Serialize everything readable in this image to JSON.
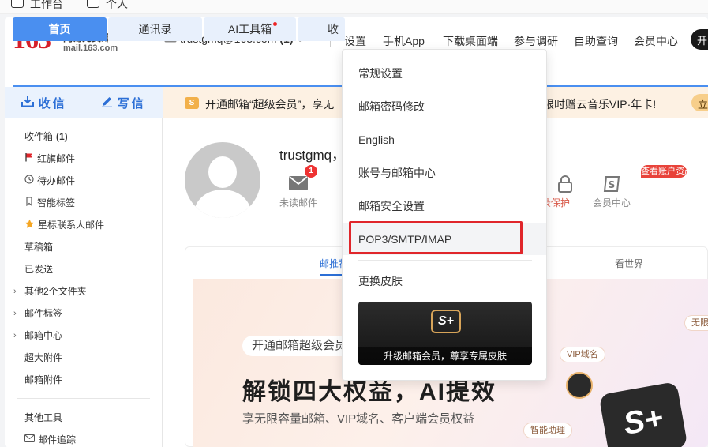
{
  "top_strip": {
    "items": [
      "工作台",
      "个人"
    ]
  },
  "header": {
    "logo_num": "163",
    "logo_cn": "网易免费邮",
    "logo_en": "mail.163.com",
    "account_email": "trustgmq@163.com",
    "account_count": "(1)",
    "nav": [
      "设置",
      "手机App",
      "下载桌面端",
      "参与调研",
      "自助查询",
      "会员中心"
    ],
    "vip_btn": "开"
  },
  "tabs": [
    {
      "label": "首页"
    },
    {
      "label": "通讯录"
    },
    {
      "label": "AI工具箱"
    },
    {
      "label": "收"
    }
  ],
  "sidebar": {
    "receive": "收信",
    "write": "写信",
    "inbox": "收件箱",
    "inbox_count": "(1)",
    "items": [
      "红旗邮件",
      "待办邮件",
      "智能标签",
      "星标联系人邮件",
      "草稿箱",
      "已发送",
      "其他2个文件夹",
      "邮件标签",
      "邮箱中心",
      "超大附件",
      "邮箱附件",
      "其他工具",
      "邮件追踪"
    ]
  },
  "banner": {
    "icon_text": "S",
    "text_left": "开通邮箱“超级会员”，享无",
    "text_right": "益，限时赠云音乐VIP·年卡!",
    "go": "立"
  },
  "profile": {
    "name": "trustgmq，",
    "unread_label": "未读邮件",
    "unread_badge": "1",
    "protect_label": "录保护",
    "member_label": "会员中心",
    "asset_badge": "查看账户资产"
  },
  "card": {
    "tab_left": "邮推荐",
    "tab_right": "看世界",
    "pill": "开通邮箱超级会员",
    "headline": "解锁四大权益，AI提效",
    "subline": "享无限容量邮箱、VIP域名、客户端会员权益",
    "tag_vip": "VIP域名",
    "tag_ai": "智能助理",
    "tag_unlimited": "无限容",
    "splus": "S+"
  },
  "settings_menu": {
    "items": [
      "常规设置",
      "邮箱密码修改",
      "English",
      "账号与邮箱中心",
      "邮箱安全设置",
      "POP3/SMTP/IMAP",
      "更换皮肤"
    ],
    "skin_logo": "S+",
    "skin_caption": "升级邮箱会员，尊享专属皮肤"
  },
  "colors": {
    "brand_red": "#d6202a",
    "accent_blue": "#4a8ff0",
    "highlight_red": "#e0262b"
  }
}
